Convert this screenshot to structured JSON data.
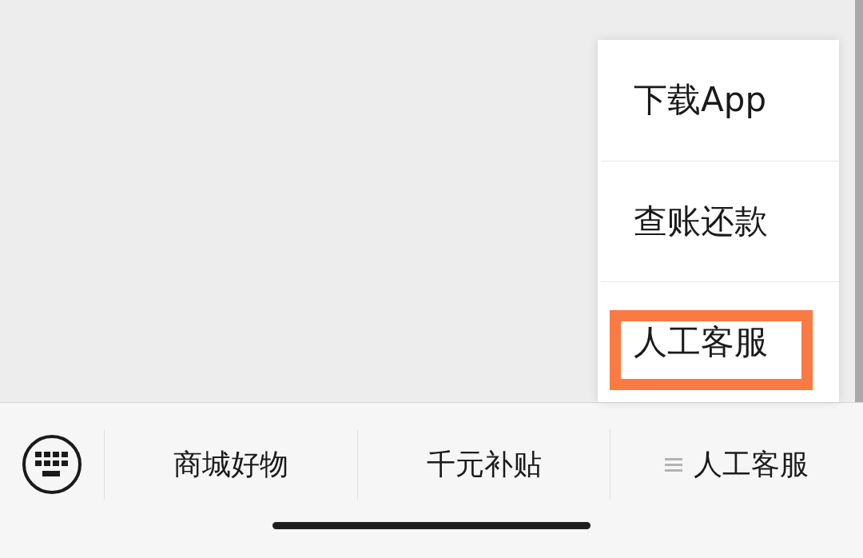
{
  "popup_menu": {
    "items": [
      {
        "label": "下载App",
        "highlighted": false
      },
      {
        "label": "查账还款",
        "highlighted": false
      },
      {
        "label": "人工客服",
        "highlighted": true
      }
    ]
  },
  "bottom_menu": {
    "tabs": [
      {
        "label": "商城好物",
        "has_submenu": false
      },
      {
        "label": "千元补贴",
        "has_submenu": false
      },
      {
        "label": "人工客服",
        "has_submenu": true
      }
    ]
  }
}
